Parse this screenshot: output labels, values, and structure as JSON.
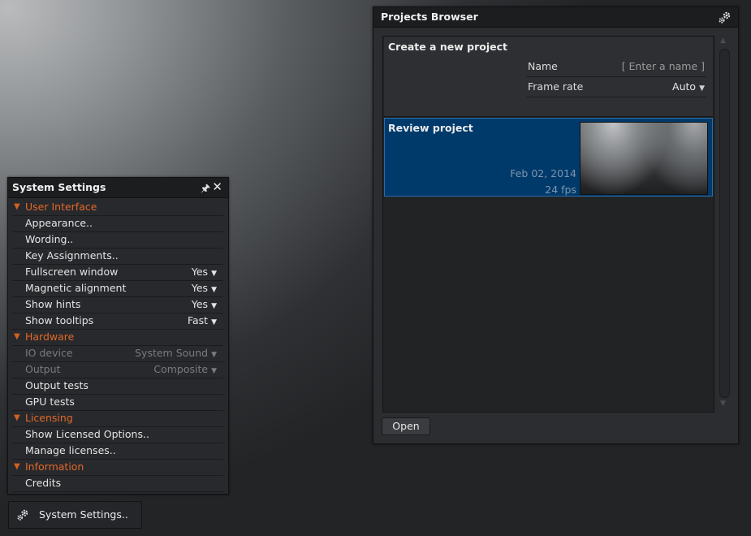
{
  "projects_browser": {
    "title": "Projects Browser",
    "create": {
      "title": "Create a new project",
      "name_label": "Name",
      "name_placeholder": "[ Enter a name ]",
      "framerate_label": "Frame rate",
      "framerate_value": "Auto"
    },
    "review": {
      "title": "Review project",
      "date": "Feb 02, 2014",
      "fps": "24 fps"
    },
    "open_label": "Open",
    "icons": {
      "settings": "gear-icon",
      "scroll_up": "scroll-up-arrow",
      "scroll_down": "scroll-down-arrow"
    }
  },
  "system_settings": {
    "title": "System Settings",
    "icons": {
      "pin": "pin-icon",
      "close": "close-icon",
      "section": "triangle-down-icon",
      "dropdown": "dropdown-arrow-icon"
    },
    "colors": {
      "section": "#e1682a",
      "selected": "#003a6b"
    },
    "rows": [
      {
        "kind": "section",
        "label": "User Interface"
      },
      {
        "kind": "item",
        "label": "Appearance.."
      },
      {
        "kind": "item",
        "label": "Wording.."
      },
      {
        "kind": "item",
        "label": "Key Assignments.."
      },
      {
        "kind": "option",
        "label": "Fullscreen window",
        "value": "Yes"
      },
      {
        "kind": "option",
        "label": "Magnetic alignment",
        "value": "Yes"
      },
      {
        "kind": "option",
        "label": "Show hints",
        "value": "Yes"
      },
      {
        "kind": "option",
        "label": "Show tooltips",
        "value": "Fast"
      },
      {
        "kind": "section",
        "label": "Hardware"
      },
      {
        "kind": "option",
        "label": "IO device",
        "value": "System Sound",
        "disabled": true
      },
      {
        "kind": "option",
        "label": "Output",
        "value": "Composite",
        "disabled": true
      },
      {
        "kind": "item",
        "label": "Output tests"
      },
      {
        "kind": "item",
        "label": "GPU tests"
      },
      {
        "kind": "section",
        "label": "Licensing"
      },
      {
        "kind": "item",
        "label": "Show Licensed Options.."
      },
      {
        "kind": "item",
        "label": "Manage licenses.."
      },
      {
        "kind": "section",
        "label": "Information"
      },
      {
        "kind": "item",
        "label": "Credits"
      }
    ]
  },
  "taskbar": {
    "system_settings_button": "System Settings.."
  }
}
